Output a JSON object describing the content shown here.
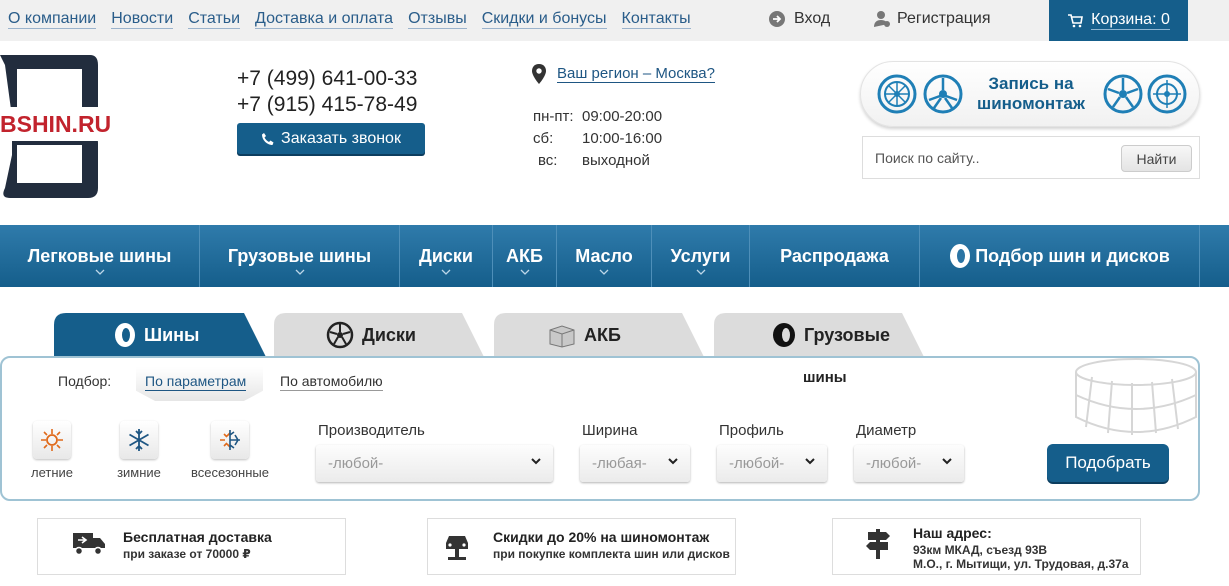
{
  "topnav": {
    "links": [
      "О компании",
      "Новости",
      "Статьи",
      "Доставка и оплата",
      "Отзывы",
      "Скидки и бонусы",
      "Контакты"
    ],
    "login": "Вход",
    "register": "Регистрация",
    "cart": "Корзина: 0"
  },
  "header": {
    "logo_text": "BSHIN.RU",
    "phone1": "+7 (499) 641-00-33",
    "phone2": "+7 (915) 415-78-49",
    "call_button": "Заказать звонок",
    "region": "Ваш регион – Москва?",
    "hours": [
      {
        "days": "пн-пт:",
        "time": "09:00-20:00"
      },
      {
        "days": "сб:",
        "time": "10:00-16:00"
      },
      {
        "days": "вс:",
        "time": "выходной"
      }
    ],
    "tire_service": "Запись на шиномонтаж",
    "search_placeholder": "Поиск по сайту..",
    "search_button": "Найти"
  },
  "mainnav": {
    "items": [
      "Легковые шины",
      "Грузовые шины",
      "Диски",
      "АКБ",
      "Масло",
      "Услуги",
      "Распродажа",
      "Подбор шин и дисков"
    ]
  },
  "tabs": [
    "Шины",
    "Диски",
    "АКБ",
    "Грузовые"
  ],
  "filter": {
    "mode_label": "Подбор:",
    "mode_params": "По параметрам",
    "mode_car": "По автомобилю",
    "heading": "шины",
    "seasons": [
      "летние",
      "зимние",
      "всесезонные"
    ],
    "fields": [
      {
        "label": "Производитель",
        "value": "-любой-"
      },
      {
        "label": "Ширина",
        "value": "-любая-"
      },
      {
        "label": "Профиль",
        "value": "-любой-"
      },
      {
        "label": "Диаметр",
        "value": "-любой-"
      }
    ],
    "submit": "Подобрать"
  },
  "info": [
    {
      "title": "Бесплатная доставка",
      "sub": "при заказе от 70000 ₽"
    },
    {
      "title": "Скидки до 20% на шиномонтаж",
      "sub": "при покупке комплекта шин или дисков"
    },
    {
      "title": "Наш адрес:",
      "sub1": "93км МКАД, съезд 93В",
      "sub2": "М.О., г. Мытищи, ул. Трудовая, д.37а"
    }
  ],
  "colors": {
    "brand": "#155e8b",
    "logo_red": "#c2232d",
    "border": "#9fc3d4"
  }
}
